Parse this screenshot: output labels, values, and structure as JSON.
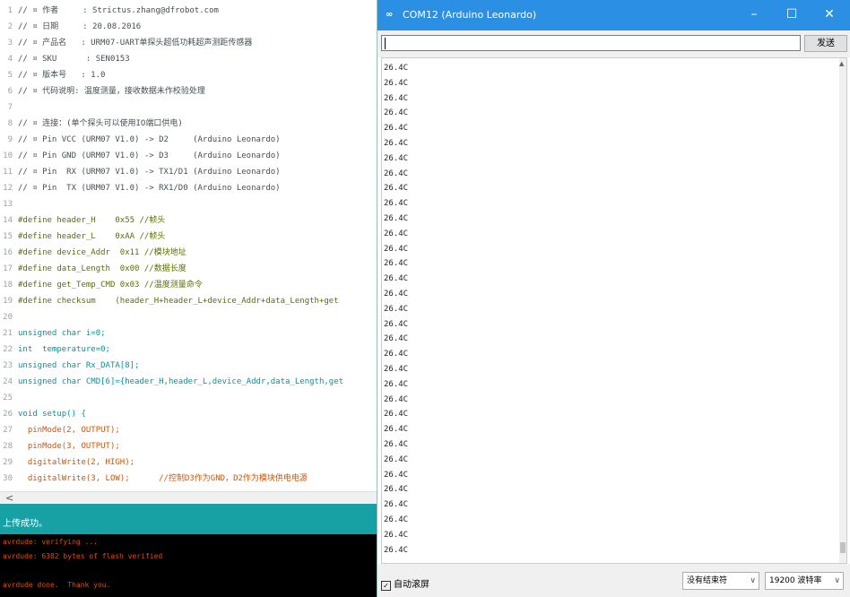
{
  "ide": {
    "code_lines": [
      {
        "n": "1",
        "text": "// ¤ 作者     : Strictus.zhang@dfrobot.com"
      },
      {
        "n": "2",
        "text": "// ¤ 日期     : 20.08.2016"
      },
      {
        "n": "3",
        "text": "// ¤ 产品名   : URM07-UART单探头超低功耗超声测距传感器"
      },
      {
        "n": "4",
        "text": "// ¤ SKU      : SEN0153"
      },
      {
        "n": "5",
        "text": "// ¤ 版本号   : 1.0"
      },
      {
        "n": "6",
        "text": "// ¤ 代码说明: 温度测量，接收数据未作校验处理"
      },
      {
        "n": "7",
        "text": ""
      },
      {
        "n": "8",
        "text": "// ¤ 连接：(单个探头可以使用IO端口供电)"
      },
      {
        "n": "9",
        "text": "// ¤ Pin VCC (URM07 V1.0) -> D2     (Arduino Leonardo)"
      },
      {
        "n": "10",
        "text": "// ¤ Pin GND (URM07 V1.0) -> D3     (Arduino Leonardo)"
      },
      {
        "n": "11",
        "text": "// ¤ Pin  RX (URM07 V1.0) -> TX1/D1 (Arduino Leonardo)"
      },
      {
        "n": "12",
        "text": "// ¤ Pin  TX (URM07 V1.0) -> RX1/D0 (Arduino Leonardo)"
      },
      {
        "n": "13",
        "text": ""
      },
      {
        "n": "14",
        "text": "#define header_H    0x55 //帧头"
      },
      {
        "n": "15",
        "text": "#define header_L    0xAA //帧头"
      },
      {
        "n": "16",
        "text": "#define device_Addr  0x11 //模块地址"
      },
      {
        "n": "17",
        "text": "#define data_Length  0x00 //数据长度"
      },
      {
        "n": "18",
        "text": "#define get_Temp_CMD 0x03 //温度测量命令"
      },
      {
        "n": "19",
        "text": "#define checksum    (header_H+header_L+device_Addr+data_Length+get"
      },
      {
        "n": "20",
        "text": ""
      },
      {
        "n": "21",
        "text": "unsigned char i=0;"
      },
      {
        "n": "22",
        "text": "int  temperature=0;"
      },
      {
        "n": "23",
        "text": "unsigned char Rx_DATA[8];"
      },
      {
        "n": "24",
        "text": "unsigned char CMD[6]={header_H,header_L,device_Addr,data_Length,get"
      },
      {
        "n": "25",
        "text": ""
      },
      {
        "n": "26",
        "text": "void setup() {"
      },
      {
        "n": "27",
        "text": "  pinMode(2, OUTPUT);"
      },
      {
        "n": "28",
        "text": "  pinMode(3, OUTPUT);"
      },
      {
        "n": "29",
        "text": "  digitalWrite(2, HIGH);"
      },
      {
        "n": "30",
        "text": "  digitalWrite(3, LOW);      //控制D3作为GND，D2作为模块供电电源"
      }
    ],
    "scroll_left": "<",
    "status_message": "上传成功。",
    "console_lines": [
      "avrdude: verifying ...",
      "avrdude: 6382 bytes of flash verified",
      "",
      "avrdude done.  Thank you."
    ]
  },
  "serial": {
    "logo": "∞",
    "title": "COM12 (Arduino Leonardo)",
    "minimize": "–",
    "maximize": "☐",
    "close": "✕",
    "send_input_value": "",
    "send_label": "发送",
    "readings": [
      "26.4C",
      "26.4C",
      "26.4C",
      "26.4C",
      "26.4C",
      "26.4C",
      "26.4C",
      "26.4C",
      "26.4C",
      "26.4C",
      "26.4C",
      "26.4C",
      "26.4C",
      "26.4C",
      "26.4C",
      "26.4C",
      "26.4C",
      "26.4C",
      "26.4C",
      "26.4C",
      "26.4C",
      "26.4C",
      "26.4C",
      "26.4C",
      "26.4C",
      "26.4C",
      "26.4C",
      "26.4C",
      "26.4C",
      "26.4C",
      "26.4C",
      "26.4C",
      "26.4C"
    ],
    "autoscroll_label": "自动滚屏",
    "autoscroll_checked": true,
    "line_ending": "没有结束符",
    "baud_rate": "19200 波特率"
  }
}
